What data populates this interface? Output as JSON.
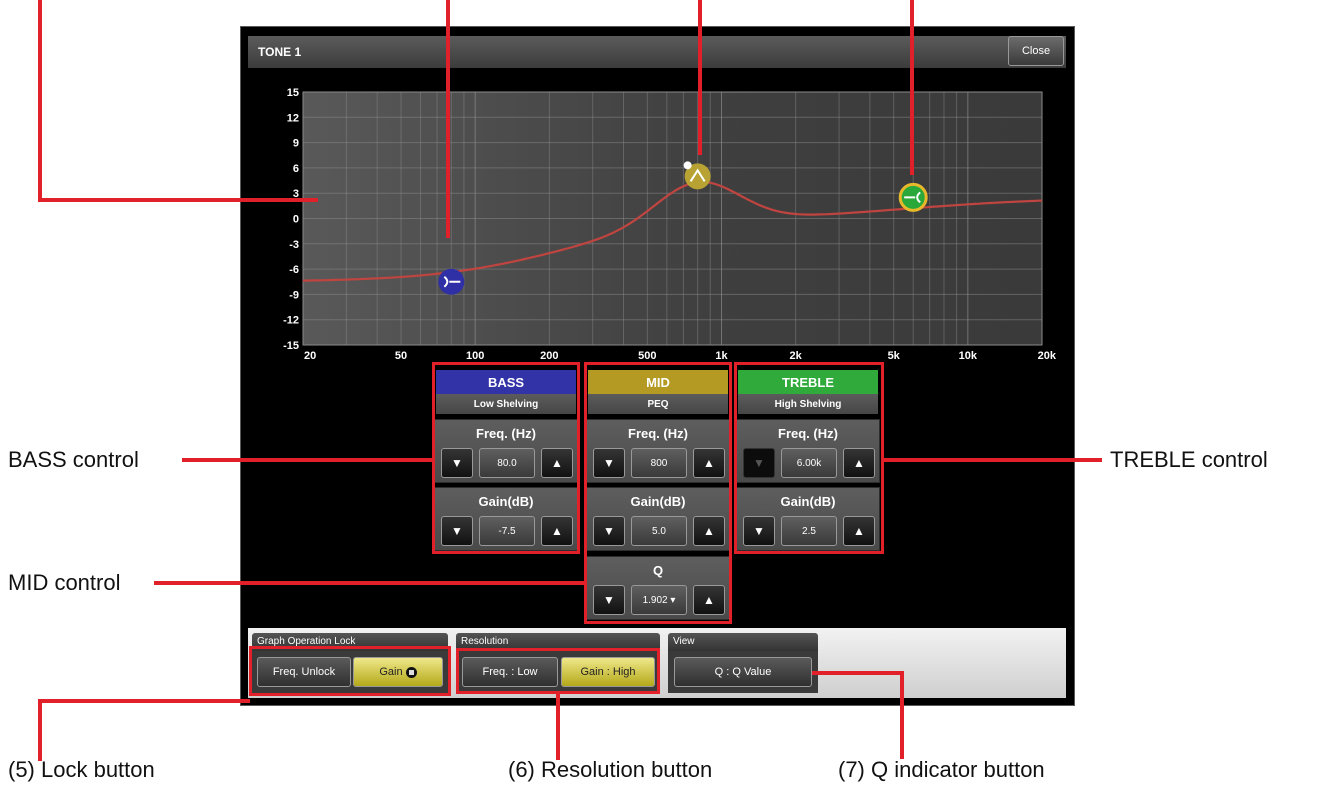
{
  "window": {
    "title": "TONE 1",
    "close_label": "Close"
  },
  "graph": {
    "y_ticks": [
      "15",
      "12",
      "9",
      "6",
      "3",
      "0",
      "-3",
      "-6",
      "-9",
      "-12",
      "-15"
    ],
    "x_ticks": [
      "20",
      "50",
      "100",
      "200",
      "500",
      "1k",
      "2k",
      "5k",
      "10k",
      "20k"
    ],
    "ylim": [
      -15,
      15
    ],
    "xlim_hz": [
      20,
      20000
    ],
    "nodes": [
      {
        "band": "bass",
        "freq_hz": 80,
        "gain_db": -7.5,
        "color": "#2f2fa6"
      },
      {
        "band": "mid",
        "freq_hz": 800,
        "gain_db": 5.0,
        "color": "#b7a233"
      },
      {
        "band": "treble",
        "freq_hz": 6000,
        "gain_db": 2.5,
        "color": "#2aa83a"
      }
    ],
    "curve_color": "#c0443f"
  },
  "bands": {
    "bass": {
      "name": "BASS",
      "type": "Low Shelving",
      "color": "#3333a8",
      "freq_label": "Freq. (Hz)",
      "freq_value": "80.0",
      "gain_label": "Gain(dB)",
      "gain_value": "-7.5"
    },
    "mid": {
      "name": "MID",
      "type": "PEQ",
      "color": "#b49a22",
      "freq_label": "Freq. (Hz)",
      "freq_value": "800",
      "gain_label": "Gain(dB)",
      "gain_value": "5.0",
      "q_label": "Q",
      "q_value": "1.902 ▾"
    },
    "treble": {
      "name": "TREBLE",
      "type": "High Shelving",
      "color": "#2faa3b",
      "freq_label": "Freq. (Hz)",
      "freq_value": "6.00k",
      "gain_label": "Gain(dB)",
      "gain_value": "2.5"
    }
  },
  "bottom": {
    "lock": {
      "label": "Graph Operation Lock",
      "freq_btn": "Freq. Unlock",
      "gain_btn": "Gain"
    },
    "resolution": {
      "label": "Resolution",
      "freq_btn": "Freq. : Low",
      "gain_btn": "Gain : High"
    },
    "view": {
      "label": "View",
      "q_btn": "Q : Q Value"
    }
  },
  "callouts": {
    "bass_control": "BASS control",
    "treble_control": "TREBLE control",
    "mid_control": "MID control",
    "lock_button": "(5) Lock button",
    "resolution_button": "(6) Resolution button",
    "q_indicator_button": "(7) Q indicator button"
  },
  "colors": {
    "accent_red": "#e2202a",
    "toggle_on": "#d6cc3d"
  }
}
